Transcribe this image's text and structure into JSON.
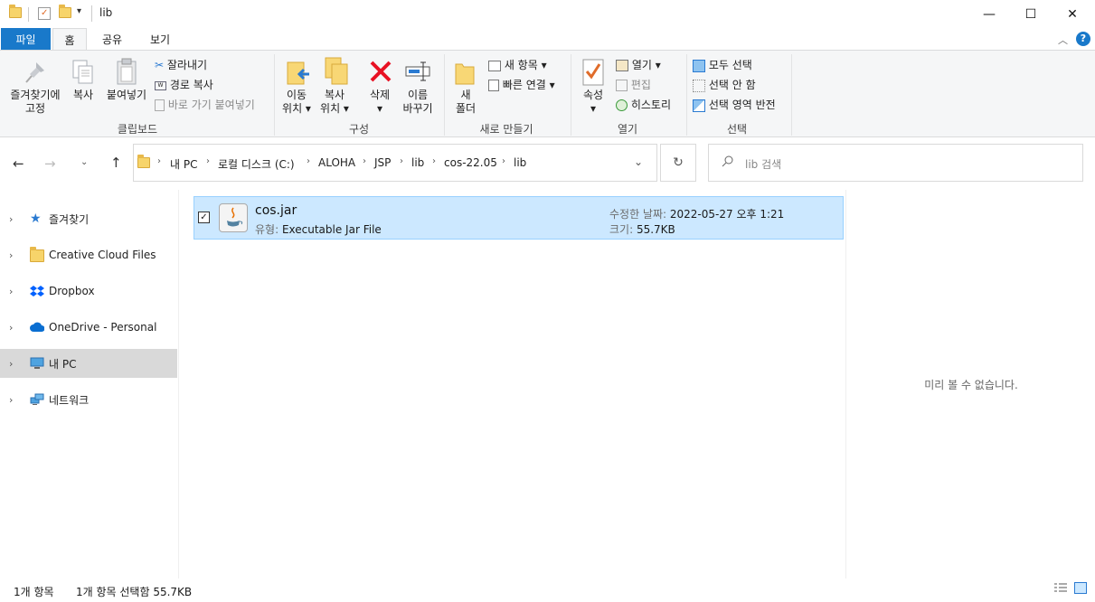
{
  "window": {
    "title": "lib",
    "controls": {
      "minimize": "—",
      "maximize": "☐",
      "close": "✕"
    }
  },
  "tabs": [
    "파일",
    "홈",
    "공유",
    "보기"
  ],
  "help": "?",
  "ribbon": {
    "clipboard": {
      "pin_label_1": "즐겨찾기에",
      "pin_label_2": "고정",
      "copy": "복사",
      "paste": "붙여넣기",
      "cut": "잘라내기",
      "copy_path": "경로 복사",
      "paste_shortcut": "바로 가기 붙여넣기",
      "group": "클립보드"
    },
    "organize": {
      "move_1": "이동",
      "move_2": "위치 ▾",
      "copyto_1": "복사",
      "copyto_2": "위치 ▾",
      "delete_1": "삭제",
      "delete_2": "▾",
      "rename_1": "이름",
      "rename_2": "바꾸기",
      "group": "구성"
    },
    "new": {
      "new_folder_1": "새",
      "new_folder_2": "폴더",
      "new_item": "새 항목 ▾",
      "easy_access": "빠른 연결 ▾",
      "group": "새로 만들기"
    },
    "open": {
      "properties_1": "속성",
      "properties_2": "▾",
      "open": "열기 ▾",
      "edit": "편집",
      "history": "히스토리",
      "group": "열기"
    },
    "select": {
      "select_all": "모두 선택",
      "select_none": "선택 안 함",
      "invert": "선택 영역 반전",
      "group": "선택"
    }
  },
  "address": {
    "crumbs": [
      "내 PC",
      "로컬 디스크 (C:)",
      "ALOHA",
      "JSP",
      "lib",
      "cos-22.05",
      "lib"
    ],
    "search_placeholder": "lib 검색"
  },
  "nav": [
    {
      "label": "즐겨찾기"
    },
    {
      "label": "Creative Cloud Files"
    },
    {
      "label": "Dropbox"
    },
    {
      "label": "OneDrive - Personal"
    },
    {
      "label": "내 PC"
    },
    {
      "label": "네트워크"
    }
  ],
  "file": {
    "name": "cos.jar",
    "type_label": "유형:",
    "type": "Executable Jar File",
    "modified_label": "수정한 날짜:",
    "modified": "2022-05-27 오후 1:21",
    "size_label": "크기:",
    "size": "55.7KB"
  },
  "preview": {
    "text": "미리 볼 수 없습니다."
  },
  "status": {
    "count": "1개 항목",
    "selected": "1개 항목 선택함 55.7KB"
  },
  "colors": {
    "accent": "#1979ca",
    "selection": "#cce8ff",
    "selection_border": "#99d1ff",
    "delete_red": "#e81123"
  }
}
